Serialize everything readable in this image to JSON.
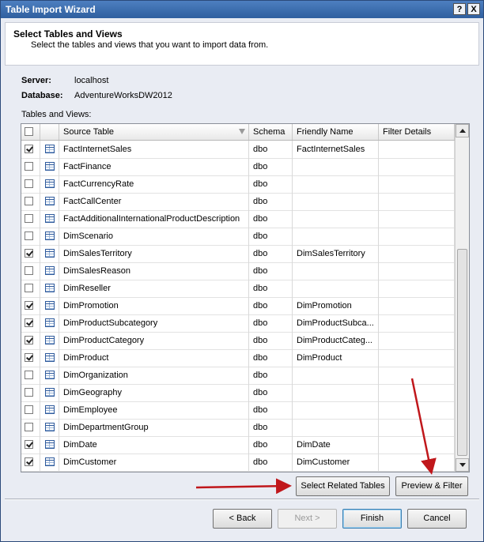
{
  "window": {
    "title": "Table Import Wizard",
    "help_label": "?",
    "close_label": "X"
  },
  "header": {
    "title": "Select Tables and Views",
    "subtitle": "Select the tables and views that you want to import data from."
  },
  "connection": {
    "server_label": "Server:",
    "server_value": "localhost",
    "database_label": "Database:",
    "database_value": "AdventureWorksDW2012"
  },
  "grid": {
    "caption": "Tables and Views:",
    "columns": [
      "Source Table",
      "Schema",
      "Friendly Name",
      "Filter Details"
    ],
    "rows": [
      {
        "checked": true,
        "source": "FactInternetSales",
        "schema": "dbo",
        "friendly": "FactInternetSales"
      },
      {
        "checked": false,
        "source": "FactFinance",
        "schema": "dbo",
        "friendly": ""
      },
      {
        "checked": false,
        "source": "FactCurrencyRate",
        "schema": "dbo",
        "friendly": ""
      },
      {
        "checked": false,
        "source": "FactCallCenter",
        "schema": "dbo",
        "friendly": ""
      },
      {
        "checked": false,
        "source": "FactAdditionalInternationalProductDescription",
        "schema": "dbo",
        "friendly": ""
      },
      {
        "checked": false,
        "source": "DimScenario",
        "schema": "dbo",
        "friendly": ""
      },
      {
        "checked": true,
        "source": "DimSalesTerritory",
        "schema": "dbo",
        "friendly": "DimSalesTerritory"
      },
      {
        "checked": false,
        "source": "DimSalesReason",
        "schema": "dbo",
        "friendly": ""
      },
      {
        "checked": false,
        "source": "DimReseller",
        "schema": "dbo",
        "friendly": ""
      },
      {
        "checked": true,
        "source": "DimPromotion",
        "schema": "dbo",
        "friendly": "DimPromotion"
      },
      {
        "checked": true,
        "source": "DimProductSubcategory",
        "schema": "dbo",
        "friendly": "DimProductSubca..."
      },
      {
        "checked": true,
        "source": "DimProductCategory",
        "schema": "dbo",
        "friendly": "DimProductCateg..."
      },
      {
        "checked": true,
        "source": "DimProduct",
        "schema": "dbo",
        "friendly": "DimProduct"
      },
      {
        "checked": false,
        "source": "DimOrganization",
        "schema": "dbo",
        "friendly": ""
      },
      {
        "checked": false,
        "source": "DimGeography",
        "schema": "dbo",
        "friendly": ""
      },
      {
        "checked": false,
        "source": "DimEmployee",
        "schema": "dbo",
        "friendly": ""
      },
      {
        "checked": false,
        "source": "DimDepartmentGroup",
        "schema": "dbo",
        "friendly": ""
      },
      {
        "checked": true,
        "source": "DimDate",
        "schema": "dbo",
        "friendly": "DimDate"
      },
      {
        "checked": true,
        "source": "DimCustomer",
        "schema": "dbo",
        "friendly": "DimCustomer"
      }
    ]
  },
  "actions": {
    "select_related": "Select Related Tables",
    "preview_filter": "Preview & Filter"
  },
  "footer": {
    "back": "< Back",
    "next": "Next >",
    "finish": "Finish",
    "cancel": "Cancel"
  },
  "annotation_color": "#c0171b"
}
